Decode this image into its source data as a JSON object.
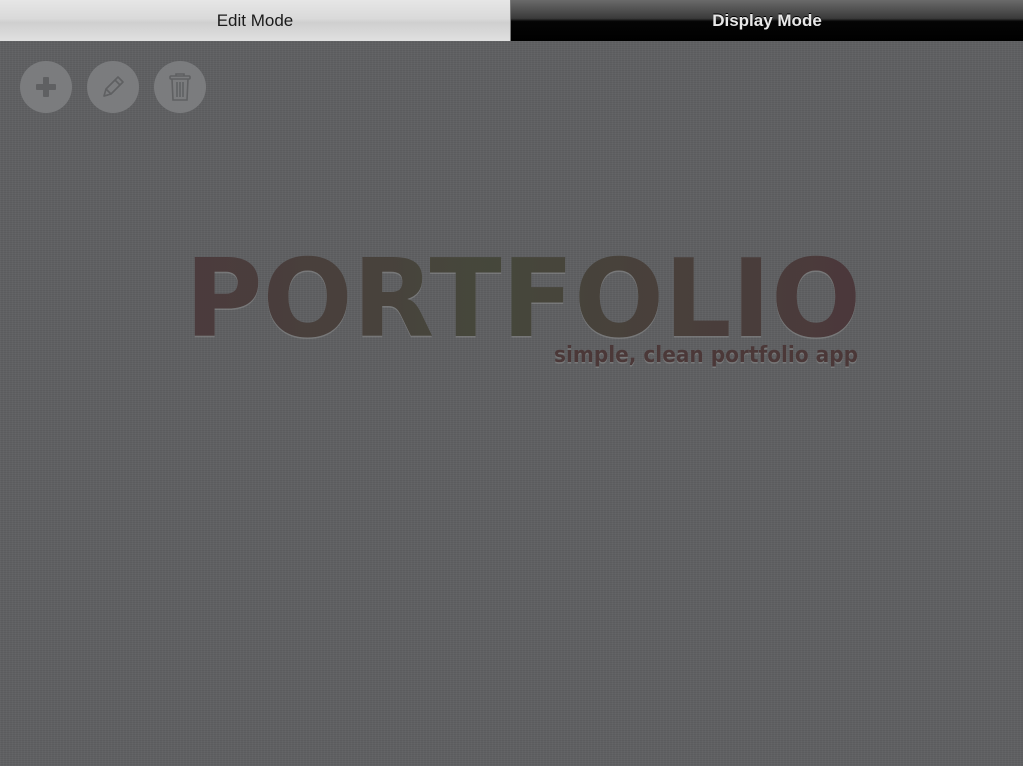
{
  "mode_switch": {
    "edit_label": "Edit Mode",
    "display_label": "Display Mode",
    "selected": "Edit Mode"
  },
  "toolbar": {
    "buttons": [
      {
        "name": "add",
        "icon": "plus-icon"
      },
      {
        "name": "edit",
        "icon": "pencil-icon"
      },
      {
        "name": "delete",
        "icon": "trash-icon"
      }
    ]
  },
  "logo": {
    "title": "PORTFOLIO",
    "tagline": "simple, clean portfolio app"
  },
  "colors": {
    "background": "#5f6062",
    "logo_text": "#4a3a3a",
    "tagline_text": "#4b3838",
    "tool_button": "#7b7c7e",
    "tool_icon": "#5f6062"
  }
}
